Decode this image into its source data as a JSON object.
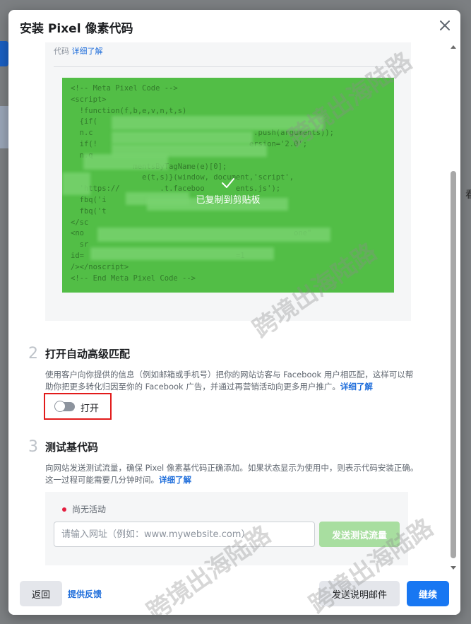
{
  "modal": {
    "title": "安装 Pixel 像素代码",
    "code_top_prefix": "代码",
    "code_top_link": "详细了解",
    "code_lines": [
      "<!-- Meta Pixel Code -->",
      "<script>",
      "  !function(f,b,e,v,n,t,s)",
      "  {if(",
      "  n.c                                    .push(arguments));",
      "  if(!                                  ersion='2.0';",
      "  n.q",
      "              mentsByTagName(e)[0];",
      "                e(t,s)}(window, document,'script',",
      "  'https://         .t.faceboo       ents.js');",
      "  fbq('i                           ');",
      "  fbq('t",
      "</sc",
      "<no                                               one\"",
      "  sr",
      "id=                                  =1",
      "/></noscript>",
      "<!-- End Meta Pixel Code -->"
    ],
    "copied_text": "已复制到剪贴板",
    "watermark": "跨境出海陆路"
  },
  "step2": {
    "number": "2",
    "title": "打开自动高级匹配",
    "desc": "使用客户向你提供的信息（例如邮箱或手机号）把你的网站访客与 Facebook 用户相匹配，这样可以帮助你把更多转化归因至你的 Facebook 广告，并通过再营销活动向更多用户推广。",
    "link": "详细了解",
    "toggle_label": "打开"
  },
  "step3": {
    "number": "3",
    "title": "测试基代码",
    "desc": "向网站发送测试流量，确保 Pixel 像素基代码正确添加。如果状态显示为使用中，则表示代码安装正确。这一过程可能需要几分钟时间。",
    "link": "详细了解",
    "status_text": "尚无活动",
    "url_placeholder": "请输入网址（例如：www.mywebsite.com）",
    "send_button": "发送测试流量"
  },
  "footer": {
    "back_button": "返回",
    "feedback_link": "提供反馈",
    "email_button": "发送说明邮件",
    "continue_button": "继续"
  },
  "colors": {
    "accent": "#1877f2",
    "code_bg": "#52be46",
    "highlight_border": "#e21b1b",
    "status_dot": "#e41e3f"
  }
}
